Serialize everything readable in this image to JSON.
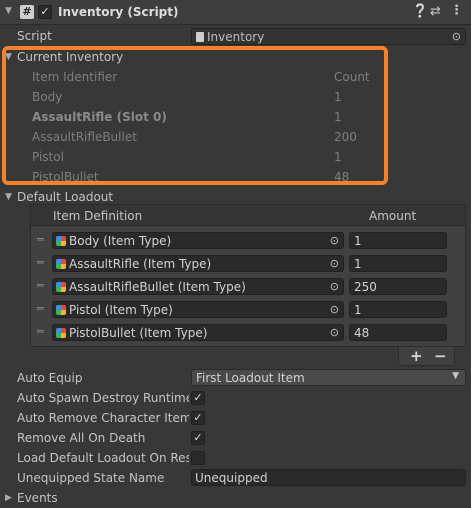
{
  "component": {
    "title": "Inventory (Script)",
    "enabled_check": "✓",
    "script_label": "Script",
    "script_value": "Inventory"
  },
  "current_inventory": {
    "label": "Current Inventory",
    "headers": {
      "identifier": "Item Identifier",
      "count": "Count"
    },
    "rows": [
      {
        "name": "Body",
        "count": "1"
      },
      {
        "name": "AssaultRifle (Slot 0)",
        "count": "1"
      },
      {
        "name": "AssaultRifleBullet",
        "count": "200"
      },
      {
        "name": "Pistol",
        "count": "1"
      },
      {
        "name": "PistolBullet",
        "count": "48"
      }
    ],
    "highlight_color": "#f4812b"
  },
  "default_loadout": {
    "label": "Default Loadout",
    "headers": {
      "definition": "Item Definition",
      "amount": "Amount"
    },
    "rows": [
      {
        "item": "Body (Item Type)",
        "amount": "1"
      },
      {
        "item": "AssaultRifle (Item Type)",
        "amount": "1"
      },
      {
        "item": "AssaultRifleBullet (Item Type)",
        "amount": "250"
      },
      {
        "item": "Pistol (Item Type)",
        "amount": "1"
      },
      {
        "item": "PistolBullet (Item Type)",
        "amount": "48"
      }
    ],
    "add_label": "+",
    "remove_label": "−"
  },
  "settings": {
    "auto_equip": {
      "label": "Auto Equip",
      "value": "First Loadout Item"
    },
    "auto_spawn": {
      "label": "Auto Spawn Destroy Runtime C",
      "checked": "✓"
    },
    "auto_remove": {
      "label": "Auto Remove Character Items",
      "checked": "✓"
    },
    "remove_all": {
      "label": "Remove All On Death",
      "checked": "✓"
    },
    "load_default": {
      "label": "Load Default Loadout On Resp",
      "checked": ""
    },
    "unequipped_state": {
      "label": "Unequipped State Name",
      "value": "Unequipped"
    }
  },
  "events": {
    "label": "Events"
  }
}
